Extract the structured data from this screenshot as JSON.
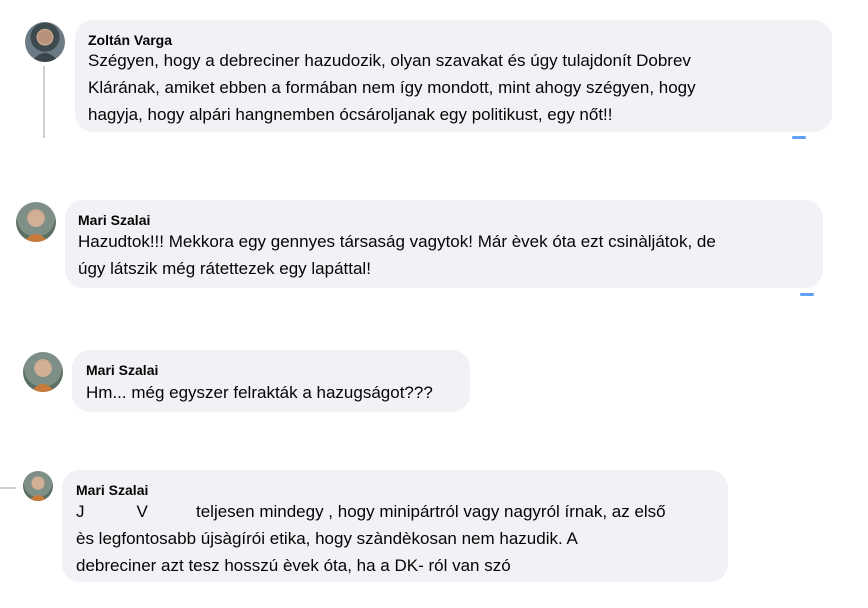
{
  "comments": [
    {
      "author": "Zoltán Varga",
      "avatar_icon": "user-avatar-photo",
      "lines": [
        "Szégyen, hogy a debreciner hazudozik, olyan szavakat és úgy tulajdonít Dobrev",
        "Klárának, amiket ebben a formában nem így mondott, mint ahogy szégyen, hogy",
        "hagyja, hogy alpári hangnemben ócsároljanak egy politikust, egy nőt!!"
      ]
    },
    {
      "author": "Mari Szalai",
      "avatar_icon": "user-avatar-photo",
      "lines": [
        "Hazudtok!!! Mekkora egy gennyes társaság vagytok! Már èvek óta ezt csinàljátok, de",
        "úgy látszik még rátettezek egy lapáttal!"
      ]
    },
    {
      "author": "Mari Szalai",
      "avatar_icon": "user-avatar-photo",
      "lines": [
        "Hm... még egyszer felrakták a hazugságot???"
      ]
    },
    {
      "author": "Mari Szalai",
      "avatar_icon": "user-avatar-photo",
      "mention_initials": [
        "J",
        "V"
      ],
      "lines": [
        "teljesen mindegy , hogy minipártról vagy nagyról írnak, az első",
        "ès legfontosabb újsàgírói etika, hogy szàndèkosan nem hazudik. A",
        "debreciner azt tesz hosszú èvek óta, ha a DK- ról van szó"
      ]
    }
  ],
  "colors": {
    "bubble": "#f0f2f5",
    "text": "#050505",
    "thread_line": "#ced0d4",
    "accent": "#1877f2"
  }
}
